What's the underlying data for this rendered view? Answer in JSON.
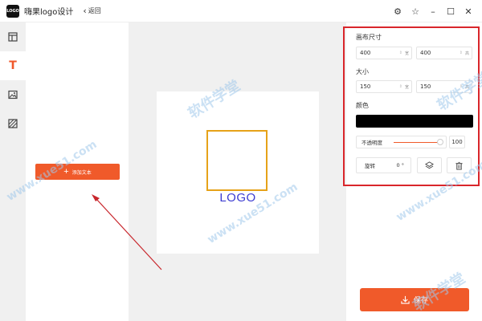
{
  "app": {
    "logo_text": "LOGO",
    "title": "嗨果logo设计",
    "back_label": "返回"
  },
  "window_icons": [
    "gear-icon",
    "star-icon",
    "minimize-icon",
    "maximize-icon",
    "close-icon"
  ],
  "rail": {
    "items": [
      {
        "name": "layout-icon",
        "active": false
      },
      {
        "name": "text-icon",
        "glyph": "T",
        "active": true
      },
      {
        "name": "image-icon",
        "active": false
      },
      {
        "name": "pattern-icon",
        "active": false
      }
    ]
  },
  "panel": {
    "add_text_label": "添加文本"
  },
  "canvas": {
    "logo_text": "LOGO",
    "frame_color": "#e6a219",
    "text_color": "#3b3bd1"
  },
  "props": {
    "canvas_size_label": "画布尺寸",
    "canvas_width": "400",
    "canvas_height": "400",
    "unit": "宽",
    "unit_h": "高",
    "size_label": "大小",
    "size_width": "150",
    "size_height": "150",
    "color_label": "颜色",
    "color_value": "#000000",
    "opacity_label": "不透明度",
    "opacity_value": "100",
    "rotation_label": "旋转",
    "rotation_value": "0",
    "rotation_unit": "°"
  },
  "save_label": "保存",
  "watermark": {
    "brand": "软件学堂",
    "site": "www.xue51.com"
  },
  "colors": {
    "accent": "#f05a2a",
    "highlight_border": "#d9262b"
  }
}
